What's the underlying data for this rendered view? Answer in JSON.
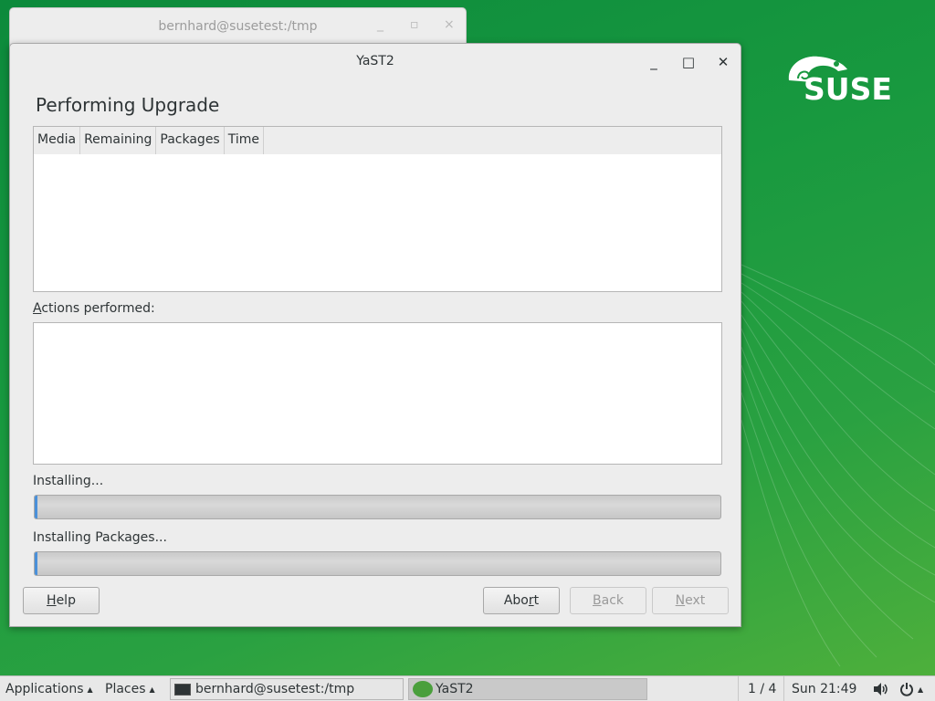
{
  "desktop": {
    "logo_text": "SUSE",
    "accent": "#1a9840"
  },
  "background_window": {
    "title": "bernhard@susetest:/tmp",
    "controls": {
      "minimize": "_",
      "maximize": "▫",
      "close": "×"
    }
  },
  "window": {
    "title": "YaST2",
    "controls": {
      "minimize": "_",
      "maximize": "□",
      "close": "✕"
    },
    "heading": "Performing Upgrade",
    "table": {
      "columns": [
        "Media",
        "Remaining",
        "Packages",
        "Time"
      ]
    },
    "actions_label_accel": "A",
    "actions_label_rest": "ctions performed:",
    "progress": [
      {
        "label": "Installing...",
        "fraction": 0.003
      },
      {
        "label": "Installing Packages...",
        "fraction": 0.003
      }
    ],
    "buttons": {
      "help": {
        "accel": "H",
        "rest": "elp"
      },
      "abort": {
        "pre": "Abo",
        "accel": "r",
        "rest": "t"
      },
      "back": {
        "accel": "B",
        "rest": "ack"
      },
      "next": {
        "accel": "N",
        "rest": "ext"
      }
    }
  },
  "taskbar": {
    "applications": "Applications",
    "places": "Places",
    "tasks": [
      "bernhard@susetest:/tmp",
      "YaST2"
    ],
    "workspace": "1 / 4",
    "clock": "Sun 21:49"
  }
}
